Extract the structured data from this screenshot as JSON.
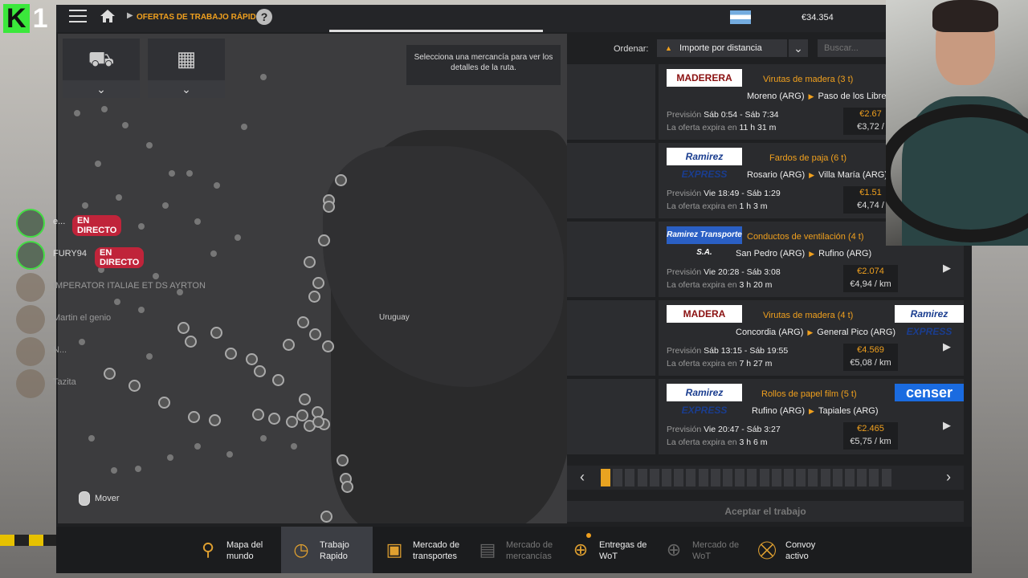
{
  "overlay": {
    "channel_logo_letter": "K",
    "channel_logo_number": "1"
  },
  "header": {
    "breadcrumb": "OFERTAS DE TRABAJO RÁPIDO",
    "help_label": "?",
    "money": "€34.354"
  },
  "map": {
    "tooltip": "Selecciona una mercancía para ver los detalles de la ruta.",
    "label_uruguay": "Uruguay",
    "move_label": "Mover",
    "filter_icons": [
      "truck-front-icon",
      "cargo-stack-icon"
    ]
  },
  "streamers": [
    {
      "name": "e...",
      "live": "EN DIRECTO"
    },
    {
      "name": "FURY94",
      "live": "EN DIRECTO"
    },
    {
      "name": "IMPERATOR ITALIAE ET DS AYRTON",
      "live": ""
    },
    {
      "name": "Martin el genio",
      "live": ""
    },
    {
      "name": "N...",
      "live": ""
    },
    {
      "name": "Tazita",
      "live": ""
    }
  ],
  "sort": {
    "label": "Ordenar:",
    "selected": "Importe por distancia",
    "search_placeholder": "Buscar..."
  },
  "jobs": [
    {
      "logo": "MADERERA",
      "logo_style": "madera",
      "logo2": "",
      "logo2_style": "",
      "cargo": "Virutas de madera (3 t)",
      "from": "Moreno (ARG)",
      "to": "Paso de los Libre",
      "prevision_label": "Previsión",
      "prevision": "Sáb 0:54 - Sáb 7:34",
      "expires_label": "La oferta expira en",
      "expires": "11 h 31 m",
      "price": "€2.67",
      "price_km": "€3,72 /"
    },
    {
      "logo": "Ramirez EXPRESS",
      "logo_style": "ramirez",
      "logo2": "",
      "logo2_style": "",
      "cargo": "Fardos de paja (6 t)",
      "from": "Rosario (ARG)",
      "to": "Villa María (ARG)",
      "prevision_label": "Previsión",
      "prevision": "Vie 18:49 - Sáb 1:29",
      "expires_label": "La oferta expira en",
      "expires": "1 h 3 m",
      "price": "€1.51",
      "price_km": "€4,74 /"
    },
    {
      "logo": "Ramirez Transporte S.A.",
      "logo_style": "ramirezblue",
      "logo2": "",
      "logo2_style": "",
      "cargo": "Conductos de ventilación (4 t)",
      "from": "San Pedro (ARG)",
      "to": "Rufino (ARG)",
      "prevision_label": "Previsión",
      "prevision": "Vie 20:28 - Sáb 3:08",
      "expires_label": "La oferta expira en",
      "expires": "3 h 20 m",
      "price": "€2.074",
      "price_km": "€4,94 / km"
    },
    {
      "logo": "MADERA",
      "logo_style": "madera",
      "logo2": "Ramirez EXPRESS",
      "logo2_style": "ramirez",
      "cargo": "Virutas de madera (4 t)",
      "from": "Concordia (ARG)",
      "to": "General Pico (ARG)",
      "prevision_label": "Previsión",
      "prevision": "Sáb 13:15 - Sáb 19:55",
      "expires_label": "La oferta expira en",
      "expires": "7 h 27 m",
      "price": "€4.569",
      "price_km": "€5,08 / km"
    },
    {
      "logo": "Ramirez EXPRESS",
      "logo_style": "ramirez",
      "logo2": "censer",
      "logo2_style": "censer",
      "cargo": "Rollos de papel film (5 t)",
      "from": "Rufino (ARG)",
      "to": "Tapiales (ARG)",
      "prevision_label": "Previsión",
      "prevision": "Vie 20:47 - Sáb 3:27",
      "expires_label": "La oferta expira en",
      "expires": "3 h 6 m",
      "price": "€2.465",
      "price_km": "€5,75 / km"
    }
  ],
  "pager": {
    "pages": 24,
    "active": 1
  },
  "accept_label": "Aceptar el trabajo",
  "bottom_tabs": [
    {
      "label": "Mapa del\nmundo",
      "icon": "map-pins-icon",
      "active": false,
      "dim": false,
      "notif": false
    },
    {
      "label": "Trabajo\nRapido",
      "icon": "clock-icon",
      "active": true,
      "dim": false,
      "notif": false
    },
    {
      "label": "Mercado de\ntransportes",
      "icon": "boxes-icon",
      "active": false,
      "dim": false,
      "notif": false
    },
    {
      "label": "Mercado de\nmercancías",
      "icon": "warehouse-icon",
      "active": false,
      "dim": true,
      "notif": false
    },
    {
      "label": "Entregas de\nWoT",
      "icon": "globe-icon",
      "active": false,
      "dim": false,
      "notif": true
    },
    {
      "label": "Mercado de\nWoT",
      "icon": "globe-dim-icon",
      "active": false,
      "dim": true,
      "notif": false
    },
    {
      "label": "Convoy\nactivo",
      "icon": "convoy-icon",
      "active": false,
      "dim": false,
      "notif": false
    }
  ],
  "colors": {
    "accent": "#f0a01e",
    "live": "#c0243a"
  }
}
